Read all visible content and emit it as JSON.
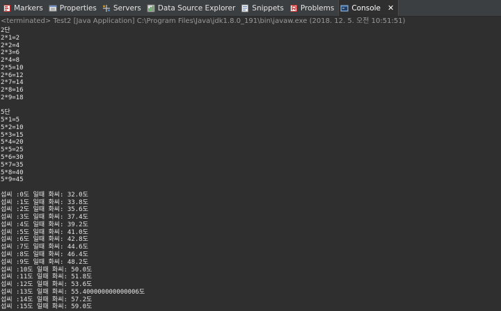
{
  "tabs": [
    {
      "name": "tab-markers",
      "icon": "markers-icon",
      "label": "Markers",
      "active": false
    },
    {
      "name": "tab-properties",
      "icon": "properties-icon",
      "label": "Properties",
      "active": false
    },
    {
      "name": "tab-servers",
      "icon": "servers-icon",
      "label": "Servers",
      "active": false
    },
    {
      "name": "tab-data-source-explorer",
      "icon": "data-source-icon",
      "label": "Data Source Explorer",
      "active": false
    },
    {
      "name": "tab-snippets",
      "icon": "snippets-icon",
      "label": "Snippets",
      "active": false
    },
    {
      "name": "tab-problems",
      "icon": "problems-icon",
      "label": "Problems",
      "active": false
    },
    {
      "name": "tab-console",
      "icon": "console-icon",
      "label": "Console",
      "active": true
    }
  ],
  "console_tab_close": "✕",
  "status": "<terminated> Test2 [Java Application] C:\\Program Files\\Java\\jdk1.8.0_191\\bin\\javaw.exe (2018. 12. 5. 오전 10:51:51)",
  "console_lines": [
    "2단",
    "2*1=2",
    "2*2=4",
    "2*3=6",
    "2*4=8",
    "2*5=10",
    "2*6=12",
    "2*7=14",
    "2*8=16",
    "2*9=18",
    "",
    "5단",
    "5*1=5",
    "5*2=10",
    "5*3=15",
    "5*4=20",
    "5*5=25",
    "5*6=30",
    "5*7=35",
    "5*8=40",
    "5*9=45",
    "",
    "섭씨 :0도 일때 화씨: 32.0도",
    "섭씨 :1도 일때 화씨: 33.8도",
    "섭씨 :2도 일때 화씨: 35.6도",
    "섭씨 :3도 일때 화씨: 37.4도",
    "섭씨 :4도 일때 화씨: 39.2도",
    "섭씨 :5도 일때 화씨: 41.0도",
    "섭씨 :6도 일때 화씨: 42.8도",
    "섭씨 :7도 일때 화씨: 44.6도",
    "섭씨 :8도 일때 화씨: 46.4도",
    "섭씨 :9도 일때 화씨: 48.2도",
    "섭씨 :10도 일때 화씨: 50.0도",
    "섭씨 :11도 일때 화씨: 51.8도",
    "섭씨 :12도 일때 화씨: 53.6도",
    "섭씨 :13도 일때 화씨: 55.400000000000006도",
    "섭씨 :14도 일때 화씨: 57.2도",
    "섭씨 :15도 일때 화씨: 59.0도"
  ],
  "colors": {
    "background": "#2f2f2f",
    "tabbar": "#3c3f41",
    "console_text": "#e8e8e8",
    "status_text": "#9a9a9a"
  }
}
